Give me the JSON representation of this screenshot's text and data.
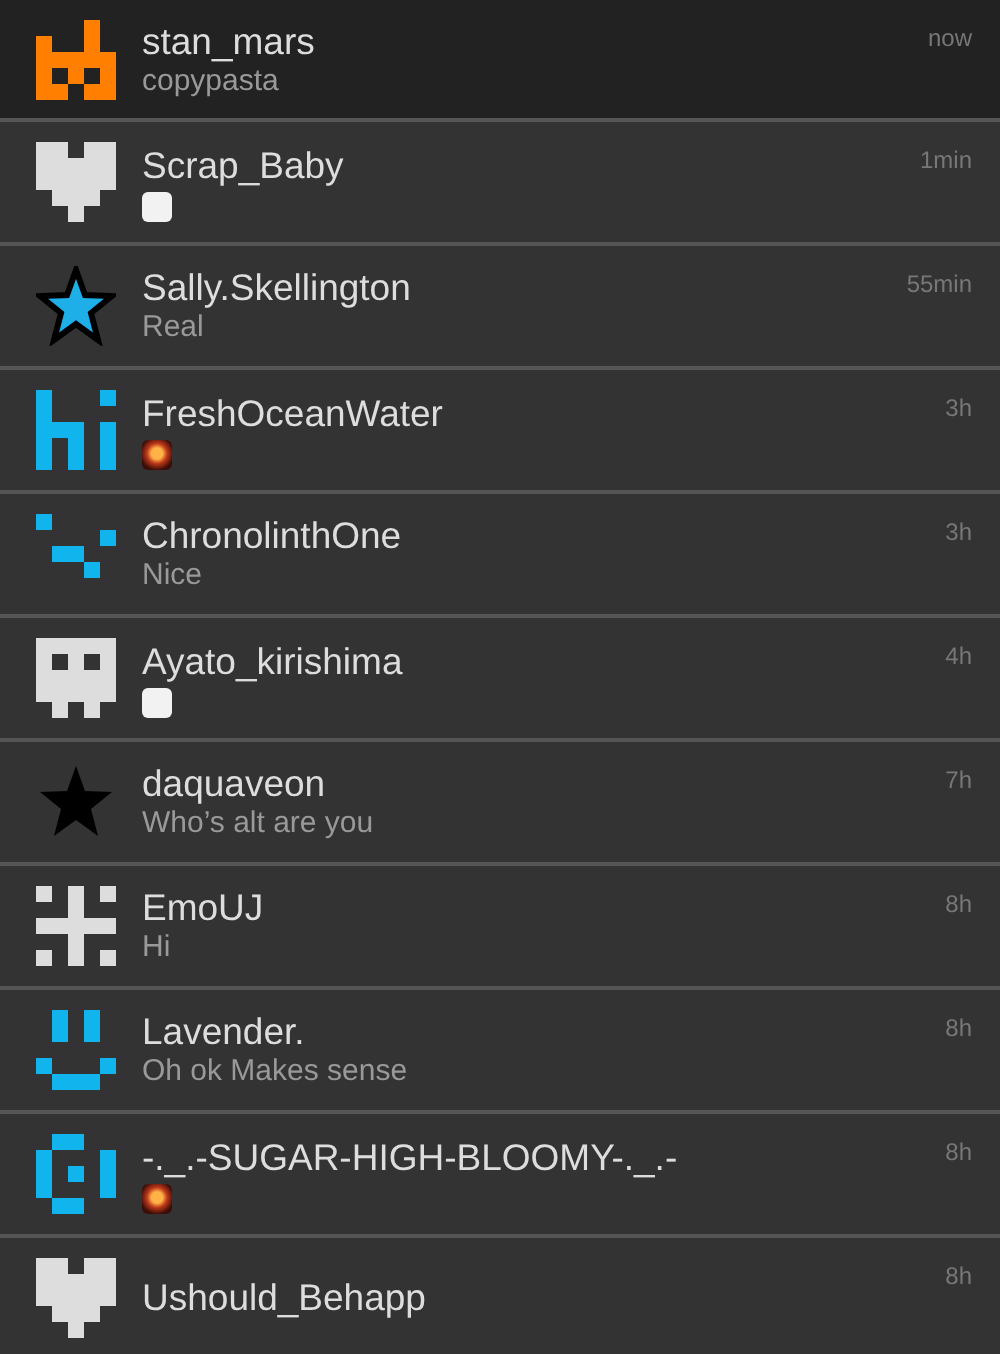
{
  "conversations": [
    {
      "name": "stan_mars",
      "message": "copypasta",
      "time": "now",
      "highlighted": true,
      "avatar": {
        "kind": "fox",
        "color": "#ff7f00"
      }
    },
    {
      "name": "Scrap_Baby",
      "attachment": {
        "kind": "sticker"
      },
      "time": "1min",
      "highlighted": false,
      "avatar": {
        "kind": "heart",
        "color": "#dddddd"
      }
    },
    {
      "name": "Sally.Skellington",
      "message": "Real",
      "time": "55min",
      "highlighted": false,
      "avatar": {
        "kind": "star-outline",
        "color": "#1eaee8"
      }
    },
    {
      "name": "FreshOceanWater",
      "attachment": {
        "kind": "explosion"
      },
      "time": "3h",
      "highlighted": false,
      "avatar": {
        "kind": "hi",
        "color": "#12b4ee"
      }
    },
    {
      "name": "ChronolinthOne",
      "message": "Nice",
      "time": "3h",
      "highlighted": false,
      "avatar": {
        "kind": "steps",
        "color": "#12b4ee"
      }
    },
    {
      "name": "Ayato_kirishima",
      "attachment": {
        "kind": "sticker"
      },
      "time": "4h",
      "highlighted": false,
      "avatar": {
        "kind": "ghost",
        "color": "#dddddd"
      }
    },
    {
      "name": "daquaveon",
      "message": "Who’s alt are you",
      "time": "7h",
      "highlighted": false,
      "avatar": {
        "kind": "star",
        "color": "#000000"
      }
    },
    {
      "name": "EmoUJ",
      "message": "Hi",
      "time": "8h",
      "highlighted": false,
      "avatar": {
        "kind": "hash",
        "color": "#dddddd"
      }
    },
    {
      "name": "Lavender.",
      "message": "Oh ok Makes sense",
      "time": "8h",
      "highlighted": false,
      "avatar": {
        "kind": "smile",
        "color": "#12b4ee"
      }
    },
    {
      "name": "-._.-SUGAR-HIGH-BLOOMY-._.-",
      "attachment": {
        "kind": "explosion"
      },
      "time": "8h",
      "highlighted": false,
      "avatar": {
        "kind": "spiral",
        "color": "#12b4ee"
      }
    },
    {
      "name": "Ushould_Behapp",
      "time": "8h",
      "highlighted": false,
      "avatar": {
        "kind": "heart",
        "color": "#dddddd"
      }
    }
  ]
}
